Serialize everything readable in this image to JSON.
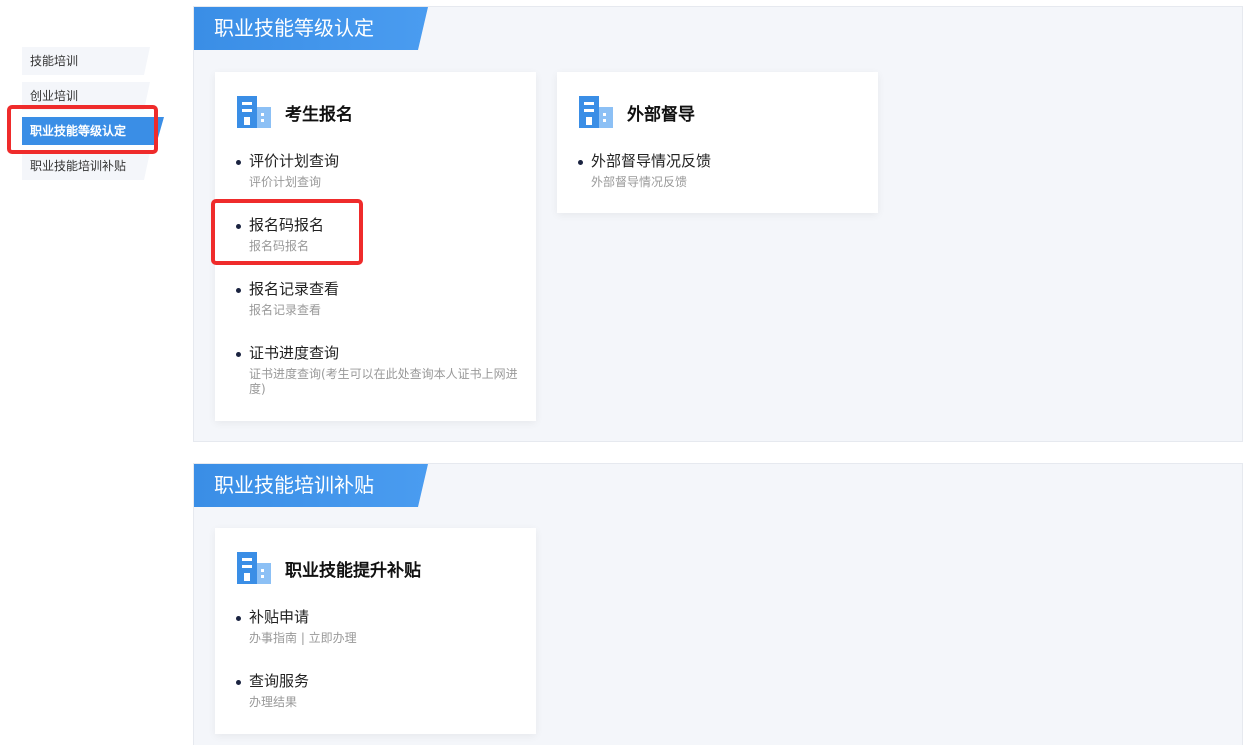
{
  "sidebar": {
    "items": [
      {
        "label": "技能培训"
      },
      {
        "label": "创业培训"
      },
      {
        "label": "职业技能等级认定"
      },
      {
        "label": "职业技能培训补贴"
      }
    ],
    "active_index": 2
  },
  "sections": [
    {
      "title": "职业技能等级认定",
      "cards": [
        {
          "title": "考生报名",
          "icon": "building-icon",
          "entries": [
            {
              "label": "评价计划查询",
              "desc": "评价计划查询"
            },
            {
              "label": "报名码报名",
              "desc": "报名码报名"
            },
            {
              "label": "报名记录查看",
              "desc": "报名记录查看"
            },
            {
              "label": "证书进度查询",
              "desc": "证书进度查询(考生可以在此处查询本人证书上网进度)"
            }
          ]
        },
        {
          "title": "外部督导",
          "icon": "building-icon",
          "entries": [
            {
              "label": "外部督导情况反馈",
              "desc": "外部督导情况反馈"
            }
          ]
        }
      ]
    },
    {
      "title": "职业技能培训补贴",
      "cards": [
        {
          "title": "职业技能提升补贴",
          "icon": "building-icon",
          "entries": [
            {
              "label": "补贴申请",
              "desc": "办事指南 | 立即办理"
            },
            {
              "label": "查询服务",
              "desc": "办理结果"
            }
          ]
        }
      ]
    }
  ],
  "colors": {
    "accent": "#3a8ee6",
    "highlight": "#ef2b2b",
    "section_bg": "#f4f6fa"
  }
}
